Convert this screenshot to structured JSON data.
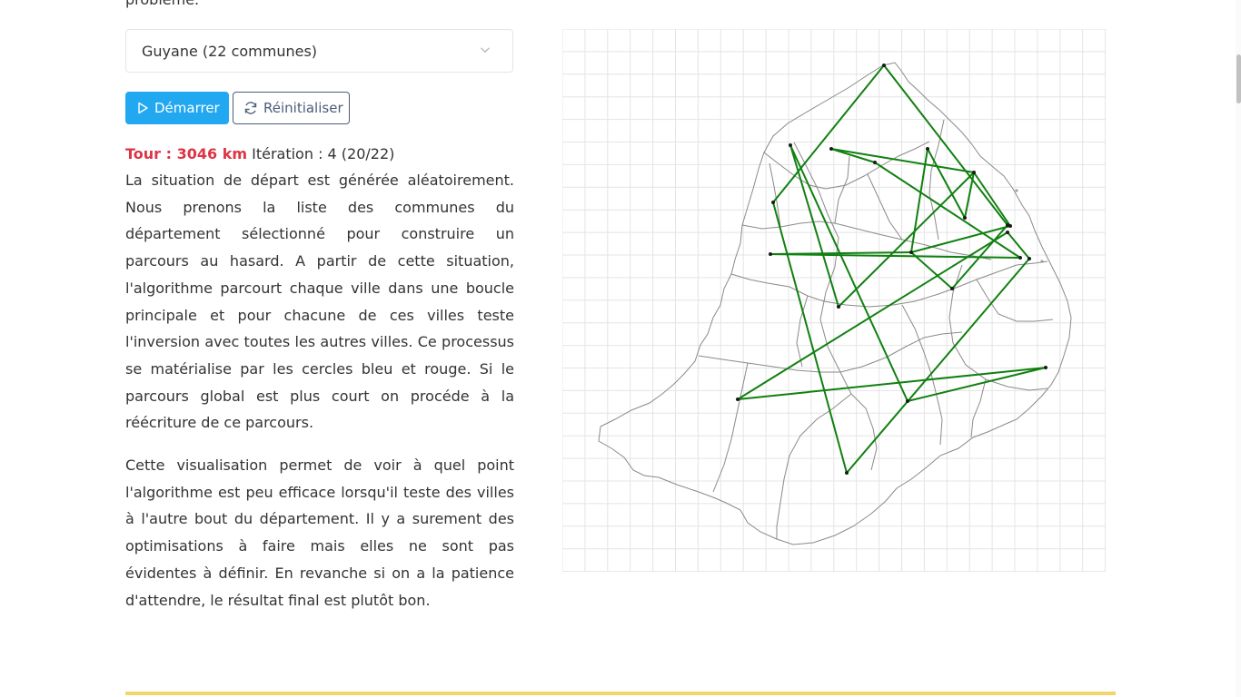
{
  "intro_tail": "problème.",
  "selector": {
    "selected": "Guyane (22 communes)"
  },
  "buttons": {
    "start_label": "Démarrer",
    "reset_label": "Réinitialiser"
  },
  "stats": {
    "tour": "Tour : 3046 km",
    "iteration": "Itération : 4 (20/22)"
  },
  "paragraphs": [
    "La situation de départ est générée aléatoirement. Nous prenons la liste des communes du département sélectionné pour construire un parcours au hasard. A partir de cette situation, l'algorithme parcourt chaque ville dans une boucle principale et pour chacune de ces villes teste l'inversion avec toutes les autres villes. Ce processus se matérialise par les cercles bleu et rouge. Si le parcours global est plus court on procéde à la réécriture de ce parcours.",
    "Cette visualisation permet de voir à quel point l'algorithme est peu efficace lorsqu'il teste des villes à l'autre bout du département. Il y a surement des optimisations à faire mais elles ne sont pas évidentes à définir. En revanche si on a la patience d'attendre, le résultat final est plutôt bon."
  ],
  "map": {
    "route_color": "#108010",
    "grid_color": "#e4e4e4",
    "outline_color": "#8a8a8a"
  },
  "colors": {
    "accent_blue": "#22a8f0",
    "tour_red": "#dc3545",
    "bar_yellow": "#f3d56d"
  }
}
